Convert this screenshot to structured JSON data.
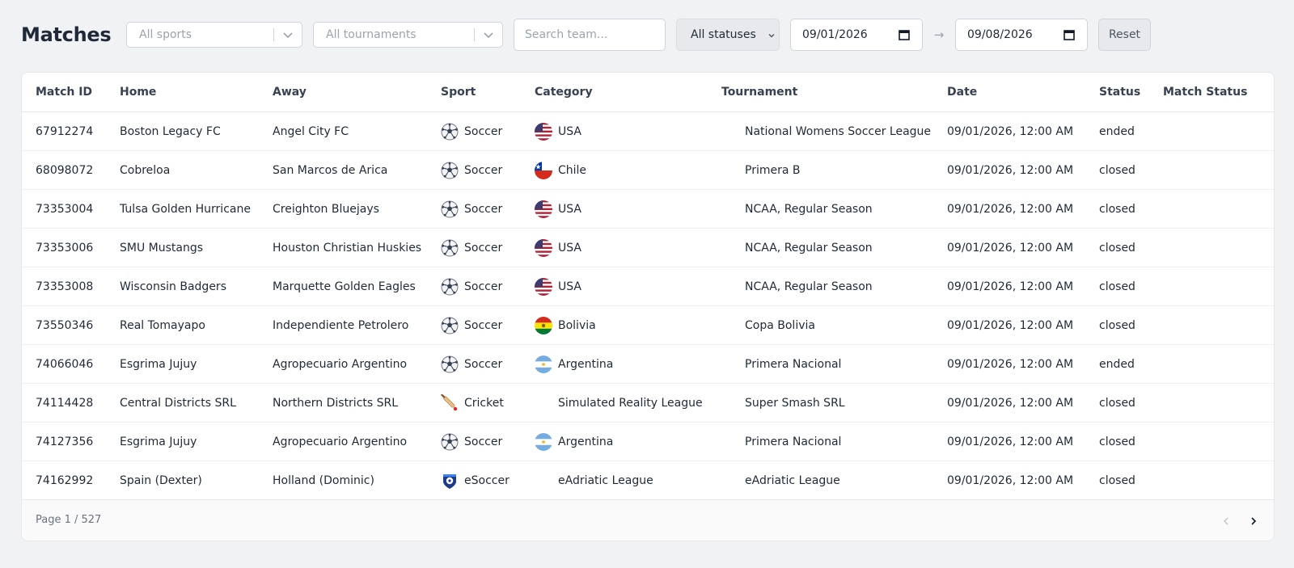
{
  "page": {
    "title": "Matches"
  },
  "filters": {
    "sports_placeholder": "All sports",
    "tournaments_placeholder": "All tournaments",
    "search_placeholder": "Search team...",
    "status_selected": "All statuses",
    "date_from": "09/01/2026",
    "date_to": "09/08/2026",
    "arrow": "→",
    "reset_label": "Reset"
  },
  "table": {
    "columns": {
      "id": "Match ID",
      "home": "Home",
      "away": "Away",
      "sport": "Sport",
      "category": "Category",
      "tournament": "Tournament",
      "date": "Date",
      "status": "Status",
      "match_status": "Match Status"
    },
    "rows": [
      {
        "id": "67912274",
        "home": "Boston Legacy FC",
        "away": "Angel City FC",
        "sport": "Soccer",
        "sport_icon": "soccer-ball-icon",
        "category": "USA",
        "flag": "usa",
        "tournament": "National Womens Soccer League",
        "date": "09/01/2026, 12:00 AM",
        "status": "ended",
        "match_status": ""
      },
      {
        "id": "68098072",
        "home": "Cobreloa",
        "away": "San Marcos de Arica",
        "sport": "Soccer",
        "sport_icon": "soccer-ball-icon",
        "category": "Chile",
        "flag": "chile",
        "tournament": "Primera B",
        "date": "09/01/2026, 12:00 AM",
        "status": "closed",
        "match_status": ""
      },
      {
        "id": "73353004",
        "home": "Tulsa Golden Hurricane",
        "away": "Creighton Bluejays",
        "sport": "Soccer",
        "sport_icon": "soccer-ball-icon",
        "category": "USA",
        "flag": "usa",
        "tournament": "NCAA, Regular Season",
        "date": "09/01/2026, 12:00 AM",
        "status": "closed",
        "match_status": ""
      },
      {
        "id": "73353006",
        "home": "SMU Mustangs",
        "away": "Houston Christian Huskies",
        "sport": "Soccer",
        "sport_icon": "soccer-ball-icon",
        "category": "USA",
        "flag": "usa",
        "tournament": "NCAA, Regular Season",
        "date": "09/01/2026, 12:00 AM",
        "status": "closed",
        "match_status": ""
      },
      {
        "id": "73353008",
        "home": "Wisconsin Badgers",
        "away": "Marquette Golden Eagles",
        "sport": "Soccer",
        "sport_icon": "soccer-ball-icon",
        "category": "USA",
        "flag": "usa",
        "tournament": "NCAA, Regular Season",
        "date": "09/01/2026, 12:00 AM",
        "status": "closed",
        "match_status": ""
      },
      {
        "id": "73550346",
        "home": "Real Tomayapo",
        "away": "Independiente Petrolero",
        "sport": "Soccer",
        "sport_icon": "soccer-ball-icon",
        "category": "Bolivia",
        "flag": "bolivia",
        "tournament": "Copa Bolivia",
        "date": "09/01/2026, 12:00 AM",
        "status": "closed",
        "match_status": ""
      },
      {
        "id": "74066046",
        "home": "Esgrima Jujuy",
        "away": "Agropecuario Argentino",
        "sport": "Soccer",
        "sport_icon": "soccer-ball-icon",
        "category": "Argentina",
        "flag": "argentina",
        "tournament": "Primera Nacional",
        "date": "09/01/2026, 12:00 AM",
        "status": "ended",
        "match_status": ""
      },
      {
        "id": "74114428",
        "home": "Central Districts SRL",
        "away": "Northern Districts SRL",
        "sport": "Cricket",
        "sport_icon": "cricket-bat-icon",
        "category": "Simulated Reality League",
        "flag": "",
        "tournament": "Super Smash SRL",
        "date": "09/01/2026, 12:00 AM",
        "status": "closed",
        "match_status": ""
      },
      {
        "id": "74127356",
        "home": "Esgrima Jujuy",
        "away": "Agropecuario Argentino",
        "sport": "Soccer",
        "sport_icon": "soccer-ball-icon",
        "category": "Argentina",
        "flag": "argentina",
        "tournament": "Primera Nacional",
        "date": "09/01/2026, 12:00 AM",
        "status": "closed",
        "match_status": ""
      },
      {
        "id": "74162992",
        "home": "Spain (Dexter)",
        "away": "Holland (Dominic)",
        "sport": "eSoccer",
        "sport_icon": "esoccer-badge-icon",
        "category": "eAdriatic League",
        "flag": "",
        "tournament": "eAdriatic League",
        "date": "09/01/2026, 12:00 AM",
        "status": "closed",
        "match_status": ""
      }
    ]
  },
  "pagination": {
    "label": "Page 1 / 527"
  }
}
